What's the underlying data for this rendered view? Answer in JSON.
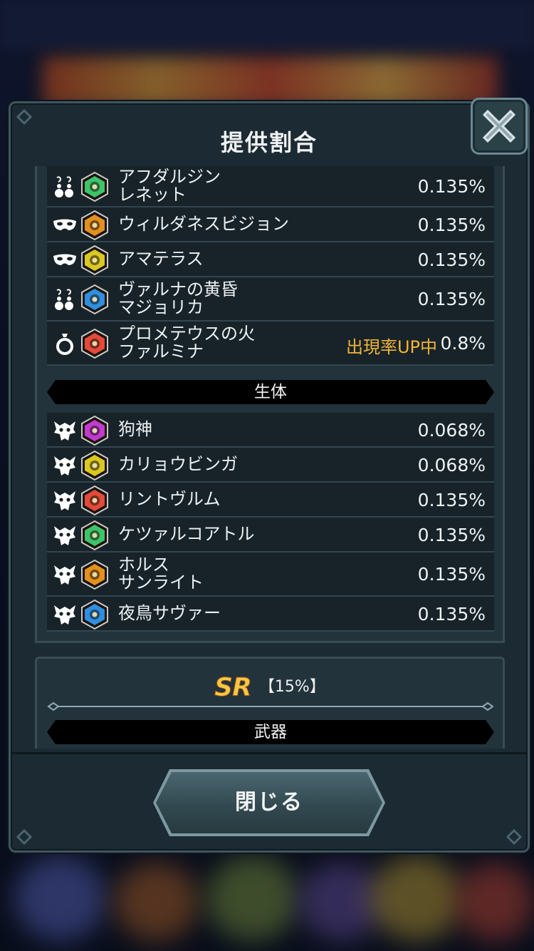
{
  "modal": {
    "title": "提供割合",
    "close_label": "閉じる"
  },
  "rows": [
    {
      "type_icon": "earrings-icon",
      "element_icon": "wind-element-icon",
      "element_color": "#3fc36a",
      "name": "アフダルジン\nレネット",
      "rate": "0.135%"
    },
    {
      "type_icon": "mask-icon",
      "element_icon": "earth-element-icon",
      "element_color": "#e3901f",
      "name": "ウィルダネスビジョン",
      "rate": "0.135%"
    },
    {
      "type_icon": "mask-icon",
      "element_icon": "light-element-icon",
      "element_color": "#d9c824",
      "name": "アマテラス",
      "rate": "0.135%"
    },
    {
      "type_icon": "earrings-icon",
      "element_icon": "water-element-icon",
      "element_color": "#2f8ee0",
      "name": "ヴァルナの黄昏\nマジョリカ",
      "rate": "0.135%"
    },
    {
      "type_icon": "ring-icon",
      "element_icon": "fire-element-icon",
      "element_color": "#e24a3a",
      "name": "プロメテウスの火\nファルミナ",
      "up": "出現率UP中",
      "rate": "0.8%"
    }
  ],
  "section_creature": "生体",
  "creature_rows": [
    {
      "type_icon": "beast-head-icon",
      "element_icon": "dark-element-icon",
      "element_color": "#c23ad0",
      "name": "狗神",
      "rate": "0.068%"
    },
    {
      "type_icon": "beast-head-icon",
      "element_icon": "light-element-icon",
      "element_color": "#d9c824",
      "name": "カリョウビンガ",
      "rate": "0.068%"
    },
    {
      "type_icon": "beast-head-icon",
      "element_icon": "fire-element-icon",
      "element_color": "#e24a3a",
      "name": "リントヴルム",
      "rate": "0.135%"
    },
    {
      "type_icon": "beast-head-icon",
      "element_icon": "wind-element-icon",
      "element_color": "#3fc36a",
      "name": "ケツァルコアトル",
      "rate": "0.135%"
    },
    {
      "type_icon": "beast-head-icon",
      "element_icon": "earth-element-icon",
      "element_color": "#e3901f",
      "name": "ホルス\nサンライト",
      "rate": "0.135%"
    },
    {
      "type_icon": "beast-head-icon",
      "element_icon": "water-element-icon",
      "element_color": "#2f8ee0",
      "name": "夜鳥サヴァー",
      "rate": "0.135%"
    }
  ],
  "sr_block": {
    "rarity": "SR",
    "percent": "【15%】",
    "section": "武器"
  },
  "colors": {
    "accent_up": "#f2b436",
    "panel": "#22333c",
    "row": "#172329"
  }
}
